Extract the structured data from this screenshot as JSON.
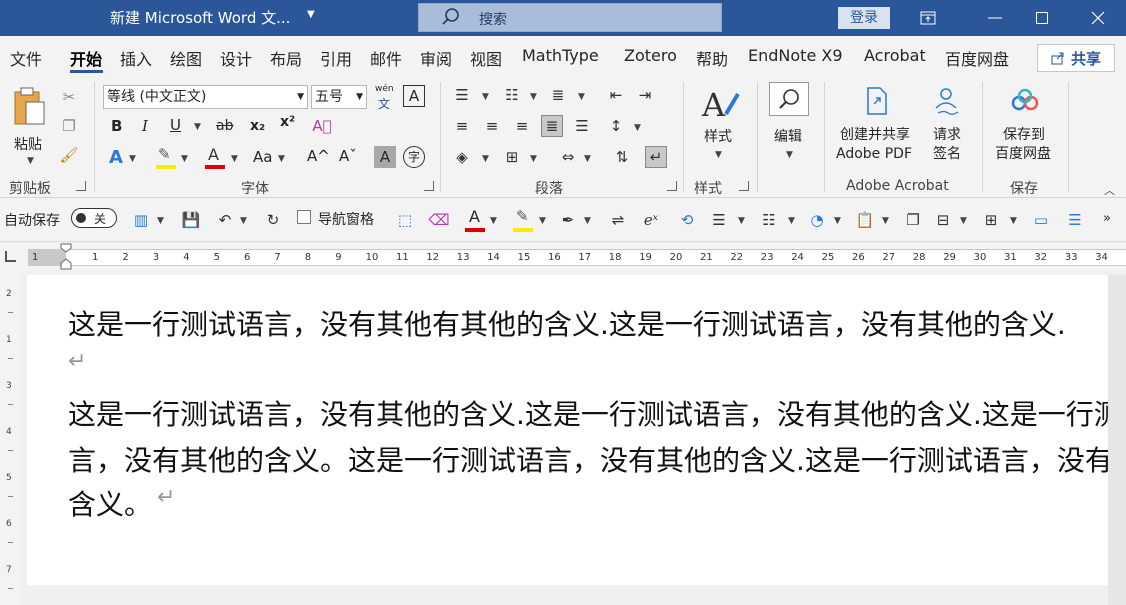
{
  "window": {
    "title": "新建 Microsoft Word 文...",
    "search_placeholder": "搜索",
    "login": "登录"
  },
  "menu": {
    "tabs": [
      "文件",
      "开始",
      "插入",
      "绘图",
      "设计",
      "布局",
      "引用",
      "邮件",
      "审阅",
      "视图",
      "MathType",
      "Zotero",
      "帮助",
      "EndNote X9",
      "Acrobat",
      "百度网盘"
    ],
    "active": "开始",
    "share": "共享"
  },
  "ribbon": {
    "clipboard": {
      "paste": "粘贴",
      "label": "剪贴板"
    },
    "font": {
      "name": "等线 (中文正文)",
      "size": "五号",
      "wen": "wén",
      "wen_char": "文",
      "bold": "B",
      "italic": "I",
      "underline": "U",
      "strike": "ab",
      "sub": "x₂",
      "sup": "x²",
      "aa": "Aa",
      "grow": "A^",
      "shrink": "Aˇ",
      "label": "字体"
    },
    "paragraph": {
      "label": "段落"
    },
    "styles": {
      "button": "样式",
      "label": "样式"
    },
    "editing": {
      "button": "编辑"
    },
    "acrobat": {
      "create_pdf_line1": "创建并共享",
      "create_pdf_line2": "Adobe PDF",
      "sign_line1": "请求",
      "sign_line2": "签名",
      "label": "Adobe Acrobat"
    },
    "save": {
      "line1": "保存到",
      "line2": "百度网盘",
      "label": "保存"
    }
  },
  "qat": {
    "autosave": "自动保存",
    "toggle": "关",
    "nav_pane": "导航窗格"
  },
  "ruler": {
    "numbers": [
      "1",
      "1",
      "2",
      "3",
      "4",
      "5",
      "6",
      "7",
      "8",
      "9",
      "10",
      "11",
      "12",
      "13",
      "14",
      "15",
      "16",
      "17",
      "18",
      "19",
      "20",
      "21",
      "22",
      "23",
      "24",
      "25",
      "26",
      "27",
      "28",
      "29",
      "30",
      "31",
      "32",
      "33",
      "34"
    ],
    "vnumbers": [
      "2",
      "1",
      "3",
      "4",
      "5",
      "6",
      "7",
      "8"
    ]
  },
  "document": {
    "para1": "这是一行测试语言，没有其他有其他的含义.这是一行测试语言，没有其他的含义.",
    "para2_line1": "这是一行测试语言，没有其他的含义.这是一行测试语言，没有其他的含义.这是一行测试语",
    "para2_line2": "言，没有其他的含义。这是一行测试语言，没有其他的含义.这是一行测试语言，没有其他的",
    "para2_line3": "含义。",
    "para_mark": "↵"
  }
}
